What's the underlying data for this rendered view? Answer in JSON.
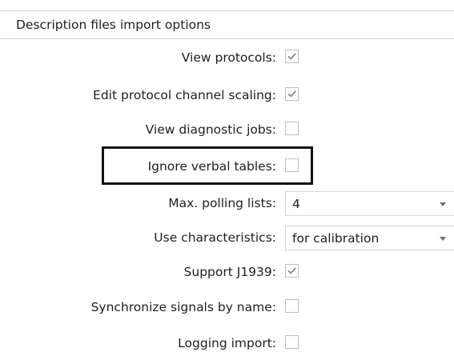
{
  "section": {
    "title": "Description files import options"
  },
  "options": [
    {
      "label": "View protocols:",
      "type": "checkbox",
      "checked": true
    },
    {
      "label": "Edit protocol channel scaling:",
      "type": "checkbox",
      "checked": true
    },
    {
      "label": "View diagnostic jobs:",
      "type": "checkbox",
      "checked": false
    },
    {
      "label": "Ignore verbal tables:",
      "type": "checkbox",
      "checked": false,
      "highlighted": true
    },
    {
      "label": "Max. polling lists:",
      "type": "dropdown",
      "value": "4"
    },
    {
      "label": "Use characteristics:",
      "type": "dropdown",
      "value": "for calibration"
    },
    {
      "label": "Support J1939:",
      "type": "checkbox",
      "checked": true
    },
    {
      "label": "Synchronize signals by name:",
      "type": "checkbox",
      "checked": false
    },
    {
      "label": "Logging import:",
      "type": "checkbox",
      "checked": false
    }
  ],
  "colors": {
    "checkmark": "#8a8a8a",
    "border": "#bdbdbd",
    "highlight": "#111111"
  }
}
